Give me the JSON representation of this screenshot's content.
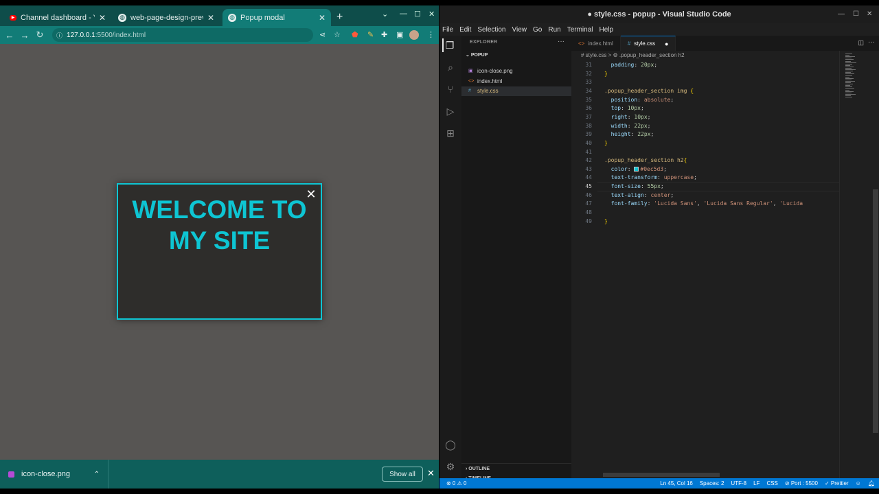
{
  "browser": {
    "tabs": [
      {
        "title": "Channel dashboard - YouTube",
        "icon": "youtube-icon"
      },
      {
        "title": "web-page-design-preview",
        "icon": "globe-icon"
      },
      {
        "title": "Popup modal",
        "icon": "globe-icon",
        "active": true
      }
    ],
    "url": {
      "host": "127.0.0.1",
      "path": ":5500/index.html"
    },
    "modal": {
      "title": "Welcome to my site",
      "accent": "#0ec5d3"
    },
    "downloads": {
      "file": "icon-close.png",
      "show_all": "Show all"
    }
  },
  "vscode": {
    "title": "● style.css - popup - Visual Studio Code",
    "menu": [
      "File",
      "Edit",
      "Selection",
      "View",
      "Go",
      "Run",
      "Terminal",
      "Help"
    ],
    "explorer": {
      "header": "EXPLORER",
      "folder": "POPUP",
      "files": [
        {
          "name": "icon-close.png",
          "icon": "image-file-icon"
        },
        {
          "name": "index.html",
          "icon": "html-file-icon"
        },
        {
          "name": "style.css",
          "icon": "css-file-icon",
          "selected": true
        }
      ],
      "outline": "OUTLINE",
      "timeline": "TIMELINE"
    },
    "editor_tabs": [
      {
        "name": "index.html",
        "icon": "html-file-icon"
      },
      {
        "name": "style.css",
        "icon": "css-file-icon",
        "active": true,
        "modified": true
      }
    ],
    "breadcrumb": "# style.css > ⚙ .popup_header_section h2",
    "code": {
      "line_numbers": [
        "31",
        "32",
        "33",
        "34",
        "35",
        "36",
        "37",
        "38",
        "39",
        "40",
        "41",
        "42",
        "43",
        "44",
        "45",
        "46",
        "47",
        "48",
        "49"
      ],
      "current_line": "45",
      "lines": [
        [
          [
            "pn",
            "  "
          ],
          [
            "prop",
            "padding"
          ],
          [
            "pn",
            ": "
          ],
          [
            "num",
            "20px"
          ],
          [
            "pn",
            ";"
          ]
        ],
        [
          [
            "br",
            "}"
          ]
        ],
        [],
        [
          [
            "sel",
            ".popup_header_section img "
          ],
          [
            "br",
            "{"
          ]
        ],
        [
          [
            "pn",
            "  "
          ],
          [
            "prop",
            "position"
          ],
          [
            "pn",
            ": "
          ],
          [
            "val",
            "absolute"
          ],
          [
            "pn",
            ";"
          ]
        ],
        [
          [
            "pn",
            "  "
          ],
          [
            "prop",
            "top"
          ],
          [
            "pn",
            ": "
          ],
          [
            "num",
            "10px"
          ],
          [
            "pn",
            ";"
          ]
        ],
        [
          [
            "pn",
            "  "
          ],
          [
            "prop",
            "right"
          ],
          [
            "pn",
            ": "
          ],
          [
            "num",
            "10px"
          ],
          [
            "pn",
            ";"
          ]
        ],
        [
          [
            "pn",
            "  "
          ],
          [
            "prop",
            "width"
          ],
          [
            "pn",
            ": "
          ],
          [
            "num",
            "22px"
          ],
          [
            "pn",
            ";"
          ]
        ],
        [
          [
            "pn",
            "  "
          ],
          [
            "prop",
            "height"
          ],
          [
            "pn",
            ": "
          ],
          [
            "num",
            "22px"
          ],
          [
            "pn",
            ";"
          ]
        ],
        [
          [
            "br",
            "}"
          ]
        ],
        [],
        [
          [
            "sel",
            ".popup_header_section h2"
          ],
          [
            "br",
            "{"
          ]
        ],
        [
          [
            "pn",
            "  "
          ],
          [
            "prop",
            "color"
          ],
          [
            "pn",
            ": "
          ],
          [
            "swatch",
            ""
          ],
          [
            "val",
            "#0ec5d3"
          ],
          [
            "pn",
            ";"
          ]
        ],
        [
          [
            "pn",
            "  "
          ],
          [
            "prop",
            "text-transform"
          ],
          [
            "pn",
            ": "
          ],
          [
            "val",
            "uppercase"
          ],
          [
            "pn",
            ";"
          ]
        ],
        [
          [
            "pn",
            "  "
          ],
          [
            "prop",
            "font-size"
          ],
          [
            "pn",
            ": "
          ],
          [
            "num",
            "55px"
          ],
          [
            "pn",
            ";"
          ]
        ],
        [
          [
            "pn",
            "  "
          ],
          [
            "prop",
            "text-align"
          ],
          [
            "pn",
            ": "
          ],
          [
            "val",
            "center"
          ],
          [
            "pn",
            ";"
          ]
        ],
        [
          [
            "pn",
            "  "
          ],
          [
            "prop",
            "font-family"
          ],
          [
            "pn",
            ": "
          ],
          [
            "val",
            "'Lucida Sans'"
          ],
          [
            "pn",
            ", "
          ],
          [
            "val",
            "'Lucida Sans Regular'"
          ],
          [
            "pn",
            ", "
          ],
          [
            "val",
            "'Lucida "
          ]
        ],
        [],
        [
          [
            "br",
            "}"
          ]
        ]
      ]
    },
    "status": {
      "problems": "⊗ 0 ⚠ 0",
      "position": "Ln 45, Col 16",
      "spaces": "Spaces: 2",
      "encoding": "UTF-8",
      "eol": "LF",
      "language": "CSS",
      "port": "⊘ Port : 5500",
      "prettier": "✓ Prettier"
    }
  }
}
